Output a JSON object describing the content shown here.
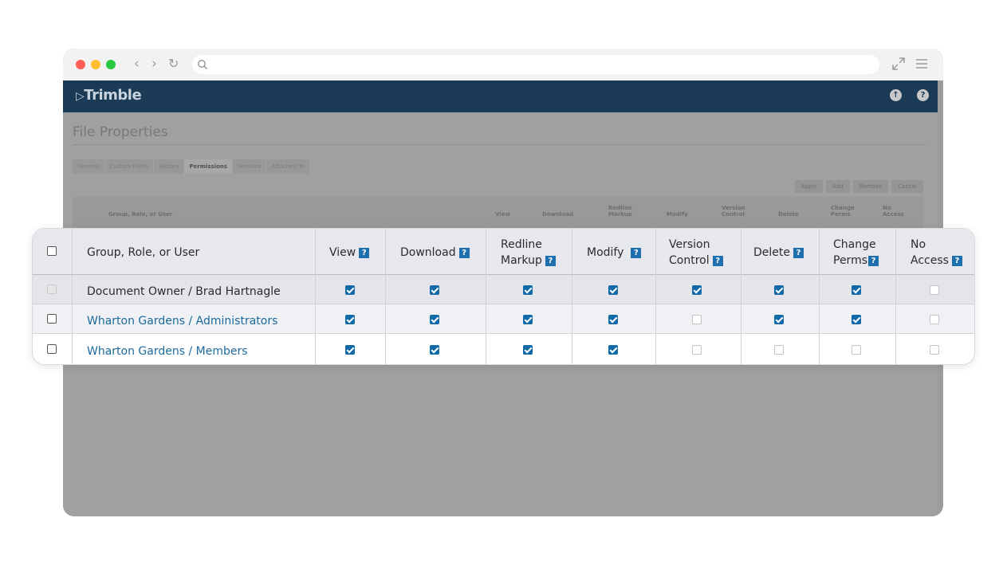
{
  "app": {
    "logo_text": "Trimble",
    "brand_color": "#1a3a56",
    "accent_color": "#1169a8"
  },
  "browser": {
    "traffic_light_colors": [
      "#ff5f57",
      "#febc2e",
      "#28c840"
    ],
    "icons": [
      "chevron-left-icon",
      "chevron-right-icon",
      "reload-icon",
      "search-icon",
      "expand-icon",
      "menu-icon"
    ],
    "address_value": ""
  },
  "background_page": {
    "title": "File Properties",
    "tabs": [
      "General",
      "Custom Fields",
      "History",
      "Permissions",
      "Versions",
      "Attached To"
    ],
    "active_tab": "Permissions",
    "buttons": [
      "Apply",
      "Add",
      "Remove",
      "Cancel"
    ],
    "columns": [
      "Group, Role, or User",
      "View",
      "Download",
      "Redline Markup",
      "Modify",
      "Version Control",
      "Delete",
      "Change Perms",
      "No Access"
    ]
  },
  "permissions_table": {
    "help_glyph": "?",
    "columns": [
      {
        "line1": "Group, Role, or User",
        "line2": ""
      },
      {
        "line1": "View",
        "line2": ""
      },
      {
        "line1": "Download",
        "line2": ""
      },
      {
        "line1": "Redline",
        "line2": "Markup"
      },
      {
        "line1": "Modify",
        "line2": ""
      },
      {
        "line1": "Version",
        "line2": "Control"
      },
      {
        "line1": "Delete",
        "line2": ""
      },
      {
        "line1": "Change",
        "line2": "Perms"
      },
      {
        "line1": "No",
        "line2": "Access"
      }
    ],
    "rows": [
      {
        "name": "Document Owner / Brad Hartnagle",
        "is_link": false,
        "select_disabled": true,
        "perms": [
          true,
          true,
          true,
          true,
          true,
          true,
          true,
          false
        ]
      },
      {
        "name": "Wharton Gardens / Administrators",
        "is_link": true,
        "select_disabled": false,
        "perms": [
          true,
          true,
          true,
          true,
          false,
          true,
          true,
          false
        ]
      },
      {
        "name": "Wharton Gardens / Members",
        "is_link": true,
        "select_disabled": false,
        "perms": [
          true,
          true,
          true,
          true,
          false,
          false,
          false,
          false
        ]
      }
    ]
  }
}
